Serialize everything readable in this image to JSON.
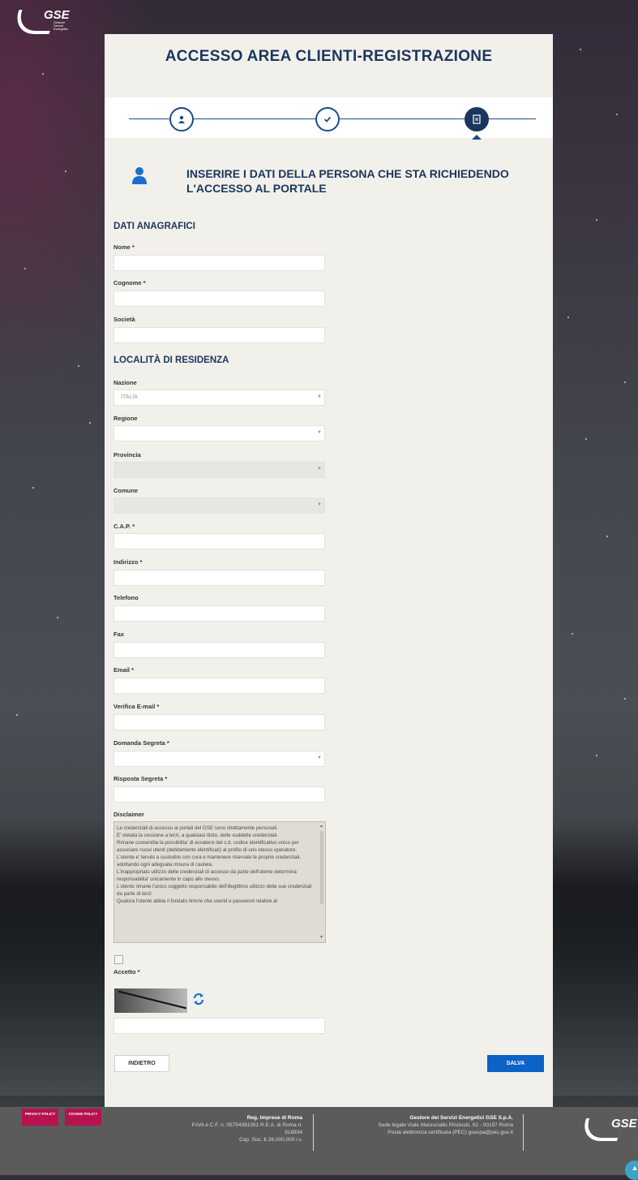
{
  "header": {
    "logo_text": "GSE",
    "logo_sub": "Gestore Servizi Energetici"
  },
  "page": {
    "title": "ACCESSO AREA CLIENTI-REGISTRAZIONE"
  },
  "section": {
    "heading_line1": "INSERIRE I DATI DELLA PERSONA CHE STA RICHIEDENDO",
    "heading_line2": "L'ACCESSO AL PORTALE"
  },
  "groups": {
    "anagrafici": "DATI ANAGRAFICI",
    "residenza": "LOCALITÀ DI RESIDENZA"
  },
  "fields": {
    "nome": {
      "label": "Nome *",
      "value": ""
    },
    "cognome": {
      "label": "Cognome *",
      "value": ""
    },
    "societa": {
      "label": "Società",
      "value": ""
    },
    "nazione": {
      "label": "Nazione",
      "value": "ITALIA"
    },
    "regione": {
      "label": "Regione",
      "value": ""
    },
    "provincia": {
      "label": "Provincia",
      "value": ""
    },
    "comune": {
      "label": "Comune",
      "value": ""
    },
    "cap": {
      "label": "C.A.P. *",
      "value": ""
    },
    "indirizzo": {
      "label": "Indirizzo *",
      "value": ""
    },
    "telefono": {
      "label": "Telefono",
      "value": ""
    },
    "fax": {
      "label": "Fax",
      "value": ""
    },
    "email": {
      "label": "Email *",
      "value": ""
    },
    "verifica_email": {
      "label": "Verifica E-mail *",
      "value": ""
    },
    "domanda": {
      "label": "Domanda Segreta *",
      "value": ""
    },
    "risposta": {
      "label": "Risposta Segreta *",
      "value": ""
    },
    "captcha": {
      "value": ""
    }
  },
  "disclaimer": {
    "label": "Disclaimer",
    "text": "Le credenziali di accesso ai portali del GSE sono strettamente personali.\nE' vietata la cessione a terzi, a qualsiasi titolo, delle suddette credenziali.\nRimane consentita la possibilita' di avvalersi del c.d. codice identificativo unico per associare nuovi utenti (debitamente identificati) al profilo di uno stesso operatore.\nL'utente e' tenuto a custodire con cura e mantenere riservate le proprie credenziali, adottando ogni adeguata misura di cautela.\nL'inappropriato utilizzo delle credenziali di accesso da parte dell'utente determina responsabilita' unicamente in capo allo stesso.\nL'utente rimane l'unico soggetto responsabile dell'illegittimo utilizzo delle sue credenziali da parte di terzi.\nQualora l'utente abbia il fondato timore che userid e password relative al"
  },
  "accept": {
    "label": "Accetto *"
  },
  "buttons": {
    "back": "INDIETRO",
    "save": "SALVA"
  },
  "footer": {
    "privacy": "PRIVACY POLICY",
    "cookie": "COOKIE POLICY",
    "reg_title": "Reg. Imprese di Roma",
    "reg_line1": "P.IVA e C.F. n. 05754381001 R.E.A. di Roma n.",
    "reg_line2": "918934",
    "reg_line3": "Cap. Soc. € 26.000.000 i.v.",
    "co_title": "Gestore dei Servizi Energetici GSE S.p.A.",
    "co_line1": "Sede legale Viale Maresciallo Pilsduski, 92 - 00197 Roma",
    "co_line2": "Posta elettronica certificata (PEC) gsespa@pec.gse.it",
    "logo_text": "GSE"
  },
  "colors": {
    "primary": "#1b365d",
    "accent": "#0c62c6",
    "policy": "#b5124f",
    "footer": "#5b5b5b"
  }
}
